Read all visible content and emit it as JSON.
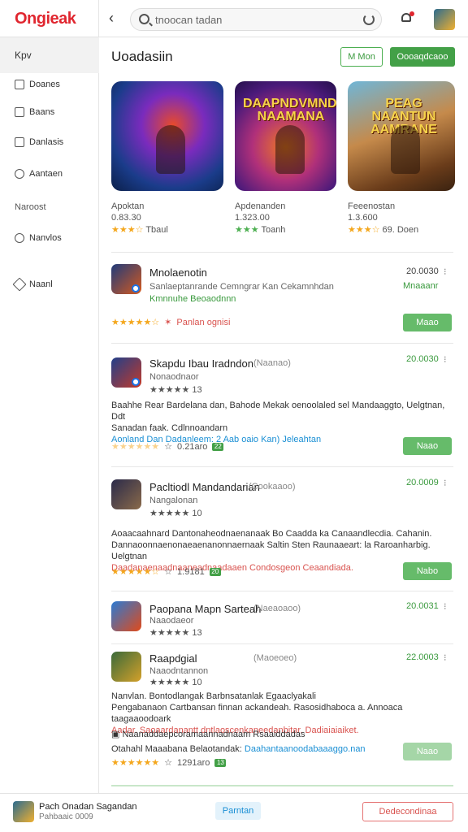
{
  "app": {
    "logo": "Ongieak"
  },
  "search": {
    "value": "tnoocan tadan"
  },
  "sidebar": {
    "header": "Kpv",
    "items": [
      {
        "label": "Doanes",
        "icon": "square-icon"
      },
      {
        "label": "Baans",
        "icon": "bag-icon"
      },
      {
        "label": "Danlasis",
        "icon": "document-icon"
      },
      {
        "label": "Aantaen",
        "icon": "search-icon"
      }
    ],
    "section": "Naroost",
    "items2": [
      {
        "label": "Nanvlos",
        "icon": "gear-icon"
      },
      {
        "label": "Naanl",
        "icon": "tag-icon"
      }
    ]
  },
  "main": {
    "title": "Uoadasiin",
    "btn_outline": "M Mon",
    "btn_green": "Oooaqdcaoo"
  },
  "featured": [
    {
      "name": "Apoktan",
      "price": "0.83.30",
      "rating": "★★★☆",
      "rating_text": "Tbaul"
    },
    {
      "name": "Apdenanden",
      "price": "1.323.00",
      "rating": "★★★",
      "rating_text": "Toanh",
      "art": "DAAPNDVMNDN NAAMANA"
    },
    {
      "name": "Feeenostan",
      "price": "1.3.600",
      "rating": "★★★☆",
      "rating_text": "69. Doen",
      "art": "PEAG NAANTUN AAMRANE"
    }
  ],
  "apps": [
    {
      "title": "Mnolaenotin",
      "sub": "Sanlaeptanrande Cemngrar Kan Cekamnhdan",
      "note_green": "Kmnnuhe Beoaodnnn",
      "price": "20.0030",
      "price_note": "Mnaaanr",
      "stars": "★★★★★☆",
      "red_note": "Panlan ognisi",
      "button": "Maao"
    },
    {
      "title": "Skapdu Ibau Iradndon",
      "tag": "(Naanao)",
      "sub": "Nonaodnaor",
      "stars_small": "★★★★★ 13",
      "price": "20.0030",
      "desc_lines": [
        "Baahhe Rear Bardelana dan, Bahode Mekak oenoolaled sel Mandaaggto, Uelgtnan, Ddt",
        "Sanadan faak. Cdlnnoandarn",
        "Aonland Dan Dadanleem: 2 Aab oaio Kan) Jeleahtan"
      ],
      "stars": "★★★★★★",
      "meta": "0.21aro",
      "badge": "22",
      "button": "Naao"
    },
    {
      "title": "Pacltiodl Mandandarian",
      "tag": "(Cookaaoo)",
      "sub": "Nangalonan",
      "stars_small": "★★★★★ 10",
      "price": "20.0009",
      "desc_lines": [
        "Aoaacaahnard Dantonaheodnaenanaak Bo Caadda ka Canaandlecdia. Cahanin.",
        "Dannaoonnaenonaeaenanonnaernaak Saltin Sten Raunaaeart: la Raroanharbig. Uelgtnan",
        "Daadanaenaadnaaneadnaadaaen Condosgeon Ceaandiada."
      ],
      "stars": "★★★★★☆",
      "meta": "1.9181",
      "badge": "20",
      "button": "Nabo"
    },
    {
      "title": "Paopana Mapn Sarteah",
      "tag": "(Naeaoaoo)",
      "sub": "Naaodaeor",
      "stars_small": "★★★★★ 13",
      "price": "20.0031"
    },
    {
      "title": "Raapdgial",
      "tag": "(Maoeoeo)",
      "sub": "Naaodntannon",
      "stars_small": "★★★★★ 10",
      "price": "22.0003",
      "desc_lines": [
        "Nanvlan. Bontodlangak Barbnsatanlak Egaaclyakali",
        "Pengabanaon Cartbansan finnan ackandeah. Rasosidhaboca a. Annoaca taagaaoodoark",
        "Aadar. Saoaardanantt dntlaoscenkaneedanbitar. Dadiaiaiaiket."
      ],
      "note_line": "Naanaddaepcoramaannadnaam Rsaaiddadas",
      "blue_prefix": "Otahahl Maaabana Belaotandak:",
      "blue_note": "Daahantaanoodabaaaggo.nan",
      "stars": "★★★★★★",
      "meta": "1291aro",
      "badge": "13",
      "button": "Naao"
    }
  ],
  "bottom": {
    "name": "Pach Onadan Sagandan",
    "sub": "Pahbaaic 0009",
    "btn1": "Parntan",
    "btn2": "Dedecondinaa"
  }
}
